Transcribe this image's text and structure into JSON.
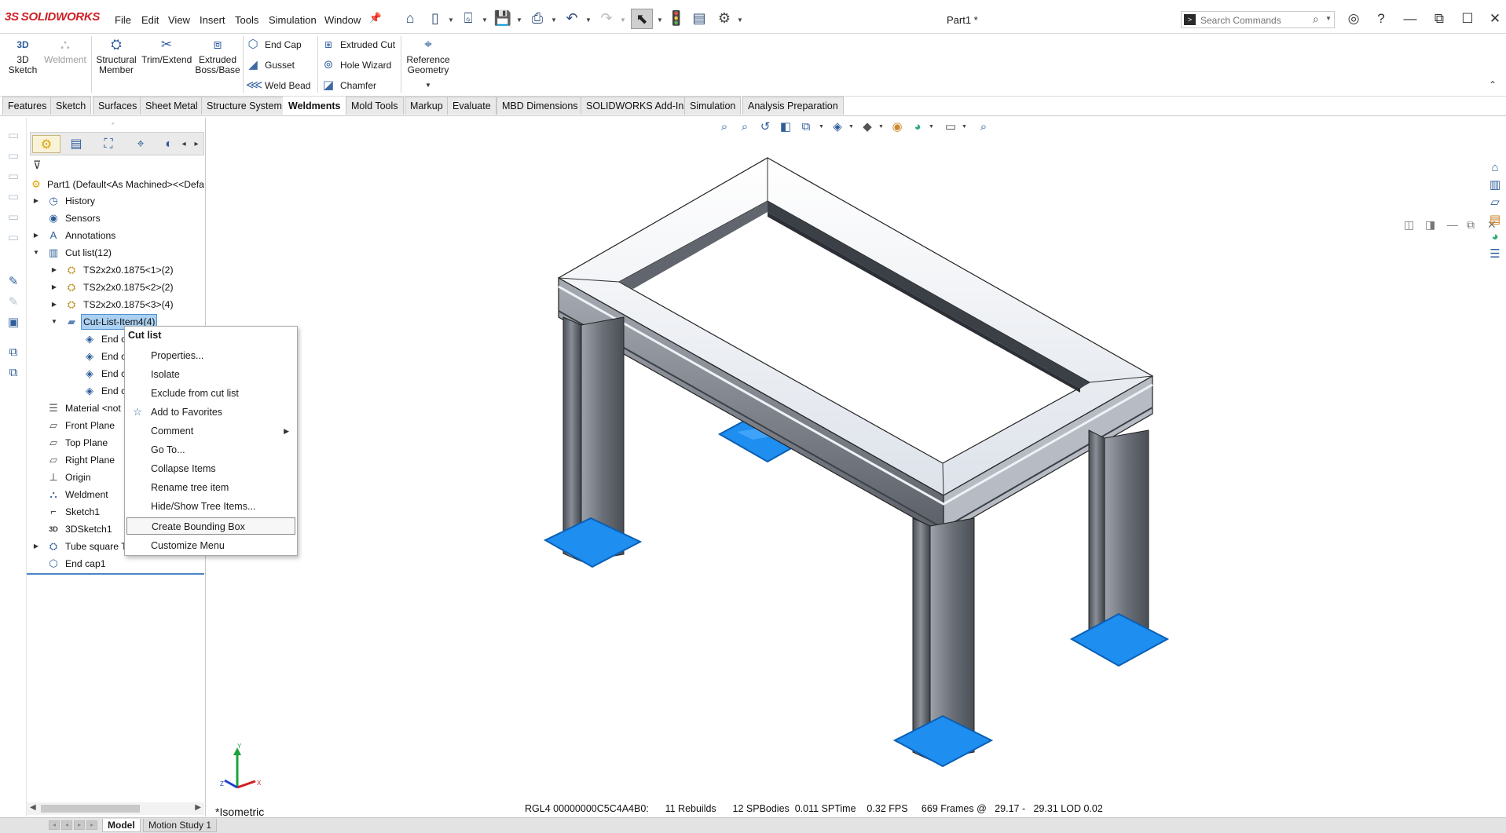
{
  "app": {
    "logo_text": "SOLIDWORKS",
    "document_title": "Part1 *",
    "menu": [
      "File",
      "Edit",
      "View",
      "Insert",
      "Tools",
      "Simulation",
      "Window"
    ]
  },
  "search": {
    "placeholder": "Search Commands"
  },
  "ribbon": {
    "big_buttons": [
      {
        "label_1": "3D",
        "label_2": "Sketch",
        "icon": "3d-sketch-icon"
      },
      {
        "label_1": "Weldment",
        "label_2": "",
        "icon": "weldment-icon"
      },
      {
        "label_1": "Structural",
        "label_2": "Member",
        "icon": "structural-member-icon"
      },
      {
        "label_1": "Trim/Extend",
        "label_2": "",
        "icon": "trim-extend-icon"
      },
      {
        "label_1": "Extruded",
        "label_2": "Boss/Base",
        "icon": "extruded-boss-icon"
      },
      {
        "label_1": "Reference",
        "label_2": "Geometry",
        "icon": "reference-geometry-icon"
      }
    ],
    "small_buttons": [
      "End Cap",
      "Gusset",
      "Weld Bead",
      "Extruded Cut",
      "Hole Wizard",
      "Chamfer"
    ]
  },
  "tabs": [
    "Features",
    "Sketch",
    "Surfaces",
    "Sheet Metal",
    "Structure System",
    "Weldments",
    "Mold Tools",
    "Markup",
    "Evaluate",
    "MBD Dimensions",
    "SOLIDWORKS Add-Ins",
    "Simulation",
    "Analysis Preparation"
  ],
  "active_tab": "Weldments",
  "tree": {
    "root": "Part1  (Default<As Machined><<Defa",
    "items": [
      {
        "label": "History"
      },
      {
        "label": "Sensors"
      },
      {
        "label": "Annotations"
      },
      {
        "label": "Cut list(12)"
      },
      {
        "label": "TS2x2x0.1875<1>(2)"
      },
      {
        "label": "TS2x2x0.1875<2>(2)"
      },
      {
        "label": "TS2x2x0.1875<3>(4)"
      },
      {
        "label": "Cut-List-Item4(4)"
      },
      {
        "label": "End c"
      },
      {
        "label": "End c"
      },
      {
        "label": "End c"
      },
      {
        "label": "End c"
      },
      {
        "label": "Material <not"
      },
      {
        "label": "Front Plane"
      },
      {
        "label": "Top Plane"
      },
      {
        "label": "Right Plane"
      },
      {
        "label": "Origin"
      },
      {
        "label": "Weldment"
      },
      {
        "label": "Sketch1"
      },
      {
        "label": "3DSketch1"
      },
      {
        "label": "Tube square T"
      },
      {
        "label": "End cap1"
      }
    ]
  },
  "context_menu": {
    "title": "Cut list",
    "items": [
      "Properties...",
      "Isolate",
      "Exclude from cut list",
      "Add to Favorites",
      "Comment",
      "Go To...",
      "Collapse Items",
      "Rename tree item",
      "Hide/Show Tree Items...",
      "Create Bounding Box",
      "Customize Menu"
    ],
    "highlighted": "Create Bounding Box"
  },
  "viewport": {
    "view_name": "*Isometric",
    "status": "RGL4 00000000C5C4A4B0:      11 Rebuilds      12 SPBodies  0.011 SPTime    0.32 FPS     669 Frames @   29.17 -   29.31 LOD 0.02",
    "triad": {
      "x": "X",
      "y": "Y",
      "z": "Z"
    }
  },
  "bottom_tabs": [
    "Model",
    "Motion Study 1"
  ],
  "colors": {
    "accent_blue": "#2f5e9b",
    "selection_blue": "#aad0f2",
    "face_highlight": "#1e90ff",
    "logo_red": "#d11f26"
  }
}
